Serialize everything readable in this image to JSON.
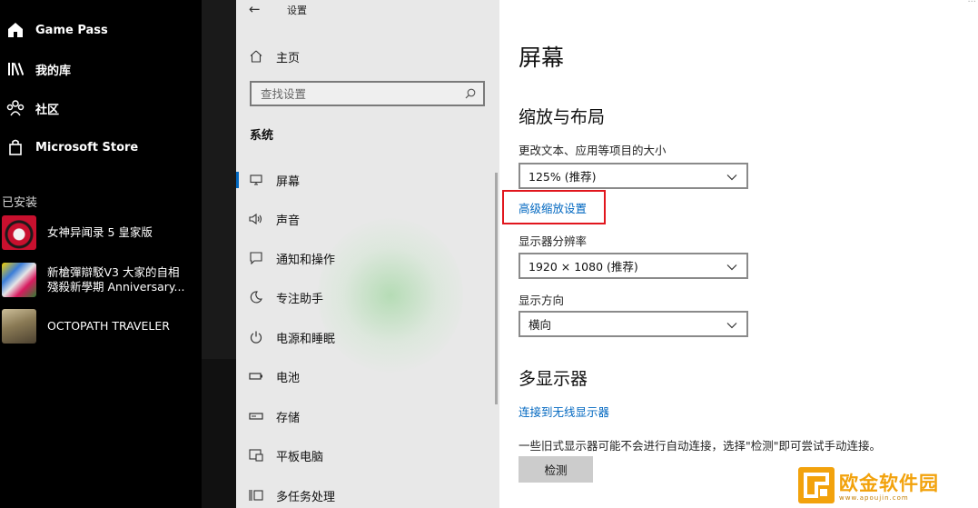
{
  "xbox": {
    "nav": [
      {
        "label": "Game Pass",
        "icon": "home-icon"
      },
      {
        "label": "我的库",
        "icon": "library-icon"
      },
      {
        "label": "社区",
        "icon": "community-icon"
      },
      {
        "label": "Microsoft Store",
        "icon": "store-icon"
      }
    ],
    "installed_title": "已安装",
    "games": [
      {
        "line1": "女神异闻录 5 皇家版",
        "line2": ""
      },
      {
        "line1": "新槍彈辯駁V3 大家的自相",
        "line2": "殘殺新學期 Anniversary..."
      },
      {
        "line1": "OCTOPATH TRAVELER",
        "line2": ""
      }
    ]
  },
  "settings": {
    "window_title": "设置",
    "home_label": "主页",
    "search_placeholder": "查找设置",
    "section_label": "系统",
    "nav_items": [
      {
        "label": "屏幕",
        "icon": "monitor-icon",
        "active": true
      },
      {
        "label": "声音",
        "icon": "speaker-icon",
        "active": false
      },
      {
        "label": "通知和操作",
        "icon": "notification-icon",
        "active": false
      },
      {
        "label": "专注助手",
        "icon": "moon-icon",
        "active": false
      },
      {
        "label": "电源和睡眠",
        "icon": "power-icon",
        "active": false
      },
      {
        "label": "电池",
        "icon": "battery-icon",
        "active": false
      },
      {
        "label": "存储",
        "icon": "storage-icon",
        "active": false
      },
      {
        "label": "平板电脑",
        "icon": "tablet-icon",
        "active": false
      },
      {
        "label": "多任务处理",
        "icon": "multitask-icon",
        "active": false
      }
    ]
  },
  "main": {
    "title": "屏幕",
    "scale_section": "缩放与布局",
    "scale_label": "更改文本、应用等项目的大小",
    "scale_value": "125% (推荐)",
    "advanced_scale_link": "高级缩放设置",
    "resolution_label": "显示器分辨率",
    "resolution_value": "1920 × 1080 (推荐)",
    "orientation_label": "显示方向",
    "orientation_value": "横向",
    "multi_display_section": "多显示器",
    "wireless_link": "连接到无线显示器",
    "detect_description": "一些旧式显示器可能不会进行自动连接，选择\"检测\"即可尝试手动连接。",
    "detect_button": "检测"
  },
  "watermark": {
    "text": "欧金软件园",
    "url": "www.apoujin.com"
  },
  "colors": {
    "xbox_bg": "#000000",
    "nav_bg": "#e8e8e8",
    "accent_link": "#0067c0",
    "highlight_box": "#e1161d",
    "watermark": "#f2a20c"
  }
}
